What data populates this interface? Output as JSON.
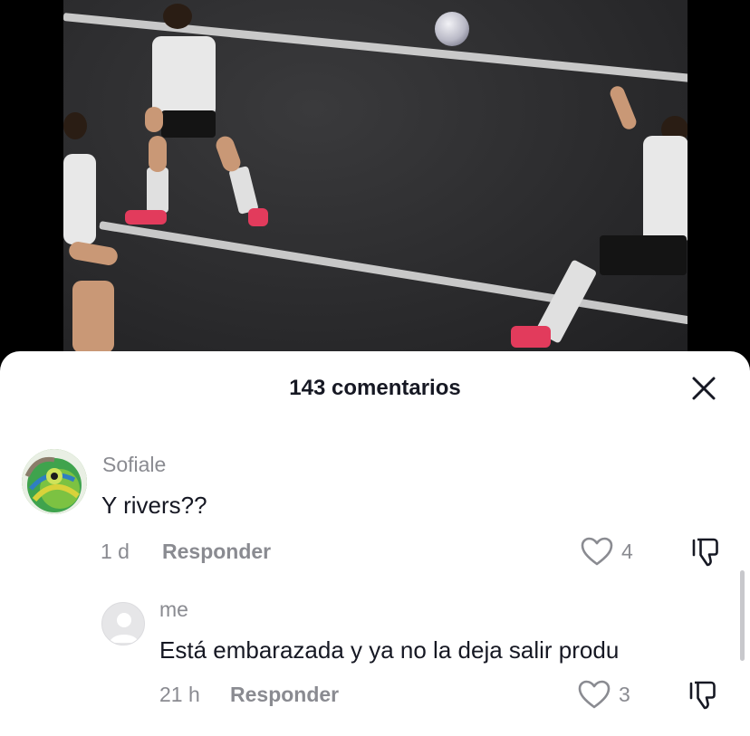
{
  "header": {
    "comment_count": "143 comentarios",
    "close_icon": "close-icon"
  },
  "comments": [
    {
      "username": "Sofiale",
      "text": "Y rivers??",
      "time": "1 d",
      "reply_label": "Responder",
      "likes": "4",
      "avatar": "chameleon-avatar"
    },
    {
      "username": "me",
      "text": "Está embarazada y ya no la deja salir produ",
      "time": "21 h",
      "reply_label": "Responder",
      "likes": "3",
      "avatar": "default-avatar"
    }
  ],
  "colors": {
    "text_primary": "#161823",
    "text_secondary": "#8a8b91",
    "sheet_bg": "#ffffff"
  }
}
